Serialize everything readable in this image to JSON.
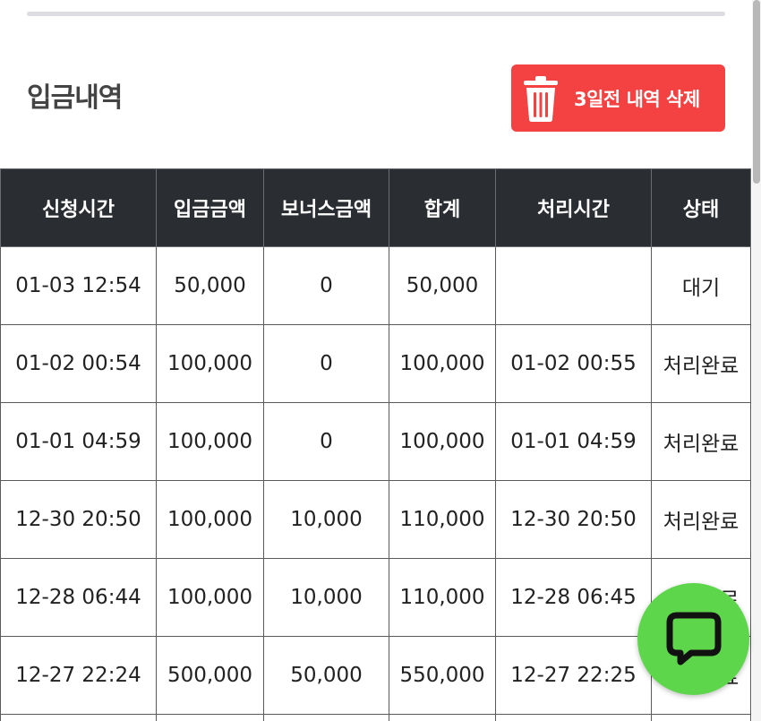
{
  "section": {
    "title": "입금내역"
  },
  "toolbar": {
    "delete_label": "3일전 내역 삭제",
    "delete_icon": "trash-icon"
  },
  "table": {
    "columns": [
      "신청시간",
      "입금금액",
      "보너스금액",
      "합계",
      "처리시간",
      "상태"
    ],
    "rows": [
      [
        "01-03 12:54",
        "50,000",
        "0",
        "50,000",
        "",
        "대기"
      ],
      [
        "01-02 00:54",
        "100,000",
        "0",
        "100,000",
        "01-02 00:55",
        "처리완료"
      ],
      [
        "01-01 04:59",
        "100,000",
        "0",
        "100,000",
        "01-01 04:59",
        "처리완료"
      ],
      [
        "12-30 20:50",
        "100,000",
        "10,000",
        "110,000",
        "12-30 20:50",
        "처리완료"
      ],
      [
        "12-28 06:44",
        "100,000",
        "10,000",
        "110,000",
        "12-28 06:45",
        "처리완료"
      ],
      [
        "12-27 22:24",
        "500,000",
        "50,000",
        "550,000",
        "12-27 22:25",
        "처리완료"
      ]
    ]
  },
  "chat": {
    "icon": "chat-bubble-icon"
  },
  "colors": {
    "accent_red": "#f44141",
    "header_bg": "#2a2d32",
    "chat_green": "#5ed64c"
  }
}
